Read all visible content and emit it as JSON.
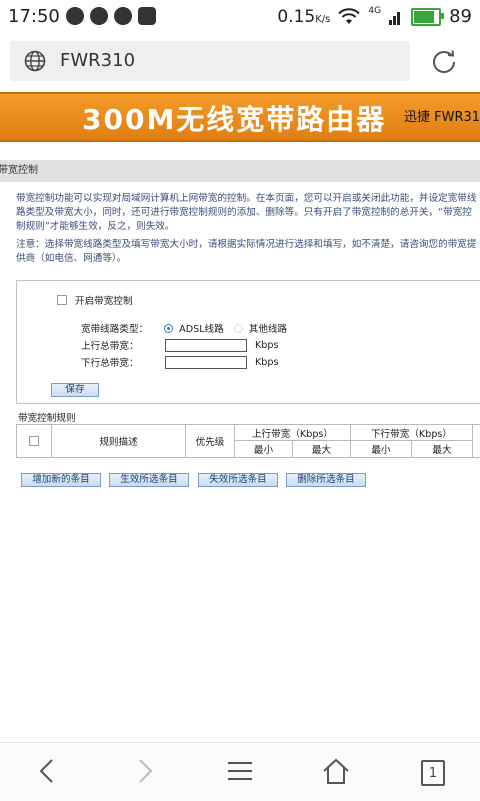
{
  "status_bar": {
    "time": "17:50",
    "speed": "0.15",
    "speed_unit": "K/s",
    "network": "4G",
    "battery": "89",
    "battery_level": 0.89,
    "battery_color": "#3aa53a"
  },
  "address_bar": {
    "url": "FWR310",
    "icons": [
      "globe-icon",
      "reload-icon"
    ]
  },
  "banner": {
    "title": "300M无线宽带路由器",
    "subtitle": "迅捷 FWR31",
    "color": "#f39b2a"
  },
  "section": {
    "title": "带宽控制"
  },
  "description": {
    "para1": "带宽控制功能可以实现对局域网计算机上网带宽的控制。在本页面，您可以开启或关闭此功能，并设定宽带线路类型及带宽大小，同时，还可进行带宽控制规则的添加、删除等。只有开启了带宽控制的总开关，“带宽控制规则”才能够生效，反之，则失效。",
    "para2": "注意：选择带宽线路类型及填写带宽大小时，请根据实际情况进行选择和填写，如不清楚，请咨询您的带宽提供商（如电信、网通等）。"
  },
  "form": {
    "enable_label": "开启带宽控制",
    "enable_checked": false,
    "line_type_label": "宽带线路类型：",
    "line_type_options": [
      "ADSL线路",
      "其他线路"
    ],
    "line_type_selected": "ADSL线路",
    "upload_label": "上行总带宽：",
    "upload_value": "",
    "upload_unit": "Kbps",
    "download_label": "下行总带宽：",
    "download_value": "",
    "download_unit": "Kbps",
    "save_label": "保存"
  },
  "rules": {
    "title": "带宽控制规则",
    "columns": {
      "desc": "规则描述",
      "priority": "优先级",
      "upload": "上行带宽（Kbps）",
      "download": "下行带宽（Kbps）",
      "min": "最小",
      "max": "最大"
    }
  },
  "actions": {
    "add": "增加新的条目",
    "enable": "生效所选条目",
    "disable": "失效所选条目",
    "delete": "删除所选条目"
  },
  "bottom_nav": {
    "tab_count": "1",
    "icons": [
      "back-icon",
      "forward-icon",
      "menu-icon",
      "home-icon",
      "tabs-icon"
    ]
  }
}
